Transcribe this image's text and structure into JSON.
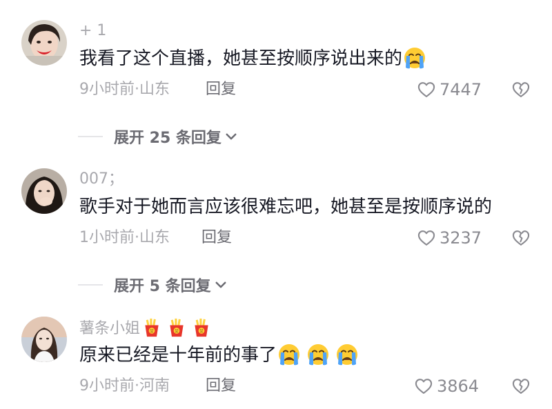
{
  "comments": [
    {
      "username": "+ 1",
      "text": "我看了这个直播，她甚至按顺序说出来的",
      "text_emojis": [
        "crying-face"
      ],
      "time": "9小时前",
      "location": "山东",
      "reply_label": "回复",
      "likes": "7447"
    },
    {
      "username": "007；",
      "text": "歌手对于她而言应该很难忘吧，她甚至是按顺序说的",
      "text_emojis": [],
      "time": "1小时前",
      "location": "山东",
      "reply_label": "回复",
      "likes": "3237"
    },
    {
      "username": "薯条小姐",
      "username_emojis": [
        "fries-icon",
        "fries-icon",
        "fries-icon"
      ],
      "text": "原来已经是十年前的事了",
      "text_emojis": [
        "crying-face",
        "crying-face",
        "crying-face"
      ],
      "time": "9小时前",
      "location": "河南",
      "reply_label": "回复",
      "likes": "3864"
    }
  ],
  "expand_replies": [
    {
      "label": "展开 25 条回复"
    },
    {
      "label": "展开 5 条回复"
    }
  ],
  "meta_separator": "·",
  "colors": {
    "text": "#161823",
    "muted": "#a8a8ad",
    "secondary": "#6b6b72",
    "emoji_face": "#ffcc33",
    "emoji_tear": "#4fa3f7",
    "fries_box": "#e8362b"
  }
}
